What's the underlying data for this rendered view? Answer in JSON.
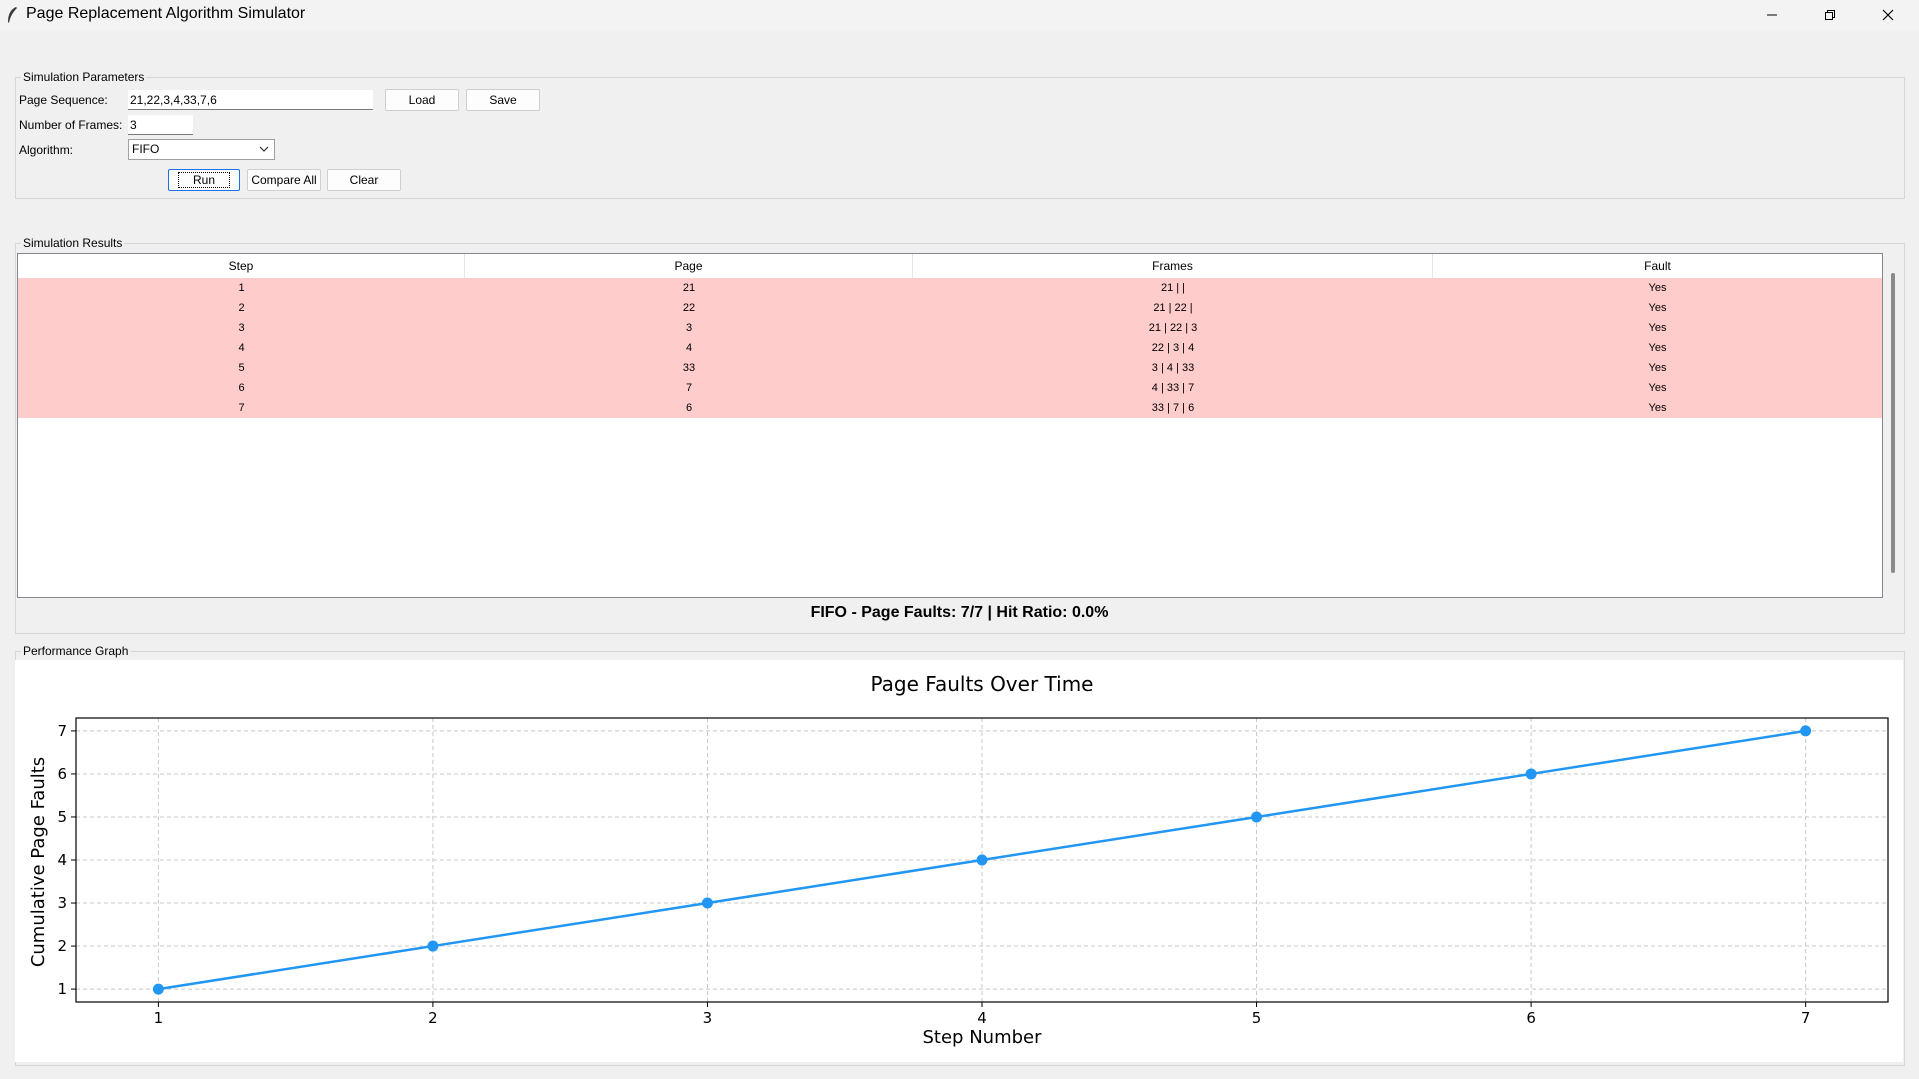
{
  "window": {
    "title": "Page Replacement Algorithm Simulator"
  },
  "params": {
    "legend": "Simulation Parameters",
    "page_sequence_label": "Page Sequence:",
    "page_sequence_value": "21,22,3,4,33,7,6",
    "load_label": "Load",
    "save_label": "Save",
    "frames_label": "Number of Frames:",
    "frames_value": "3",
    "algorithm_label": "Algorithm:",
    "algorithm_value": "FIFO",
    "run_label": "Run",
    "compare_label": "Compare All",
    "clear_label": "Clear"
  },
  "results": {
    "legend": "Simulation Results",
    "columns": [
      "Step",
      "Page",
      "Frames",
      "Fault"
    ],
    "rows": [
      [
        "1",
        "21",
        "21 |  | ",
        "Yes"
      ],
      [
        "2",
        "22",
        "21 | 22 | ",
        "Yes"
      ],
      [
        "3",
        "3",
        "21 | 22 | 3",
        "Yes"
      ],
      [
        "4",
        "4",
        "22 | 3 | 4",
        "Yes"
      ],
      [
        "5",
        "33",
        "3 | 4 | 33",
        "Yes"
      ],
      [
        "6",
        "7",
        "4 | 33 | 7",
        "Yes"
      ],
      [
        "7",
        "6",
        "33 | 7 | 6",
        "Yes"
      ]
    ],
    "fault_row_color": "#ffcccc",
    "summary": "FIFO - Page Faults: 7/7 | Hit Ratio: 0.0%"
  },
  "graph": {
    "legend": "Performance Graph"
  },
  "chart_data": {
    "type": "line",
    "title": "Page Faults Over Time",
    "xlabel": "Step Number",
    "ylabel": "Cumulative Page Faults",
    "x": [
      1,
      2,
      3,
      4,
      5,
      6,
      7
    ],
    "y": [
      1,
      2,
      3,
      4,
      5,
      6,
      7
    ],
    "xlim": [
      0.7,
      7.3
    ],
    "ylim": [
      0.7,
      7.3
    ],
    "xticks": [
      1,
      2,
      3,
      4,
      5,
      6,
      7
    ],
    "yticks": [
      1,
      2,
      3,
      4,
      5,
      6,
      7
    ],
    "grid": true,
    "line_color": "#2196f3"
  }
}
